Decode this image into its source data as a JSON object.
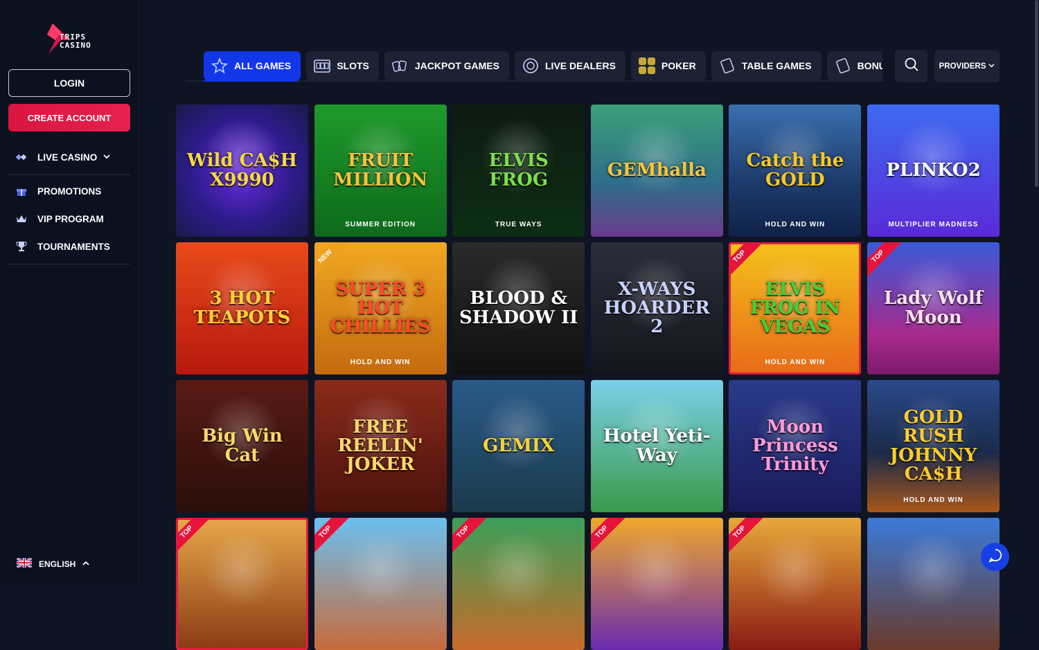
{
  "brand": {
    "logo_line1": "TRIPS",
    "logo_line2": "CASINO",
    "accent": "#e8204f",
    "primary": "#1237e8"
  },
  "sidebar": {
    "login_label": "LOGIN",
    "create_label": "CREATE ACCOUNT",
    "items": [
      {
        "label": "LIVE CASINO",
        "icon": "cards-icon"
      },
      {
        "label": "PROMOTIONS",
        "icon": "gift-icon"
      },
      {
        "label": "VIP PROGRAM",
        "icon": "crown-icon"
      },
      {
        "label": "TOURNAMENTS",
        "icon": "trophy-icon"
      }
    ],
    "language": "ENGLISH"
  },
  "tabs": [
    {
      "label": "ALL GAMES",
      "icon": "star-icon",
      "active": true
    },
    {
      "label": "SLOTS",
      "icon": "slot-machine-icon"
    },
    {
      "label": "JACKPOT GAMES",
      "icon": "jackpot-cards-icon"
    },
    {
      "label": "LIVE DEALERS",
      "icon": "chip-icon"
    },
    {
      "label": "POKER",
      "icon": "poker-icon"
    },
    {
      "label": "TABLE GAMES",
      "icon": "table-card-icon"
    },
    {
      "label": "BONUS B",
      "icon": "bonus-card-icon"
    }
  ],
  "providers_label": "PROVIDERS",
  "games": [
    {
      "title": "Wild CA$H X9990",
      "sub": "",
      "bg": "radial-gradient(circle,#6a2be0 0%,#2d1b8a 55%,#191a4a 100%)",
      "color": "#f6d845"
    },
    {
      "title": "FRUIT MILLION",
      "sub": "SUMMER EDITION",
      "bg": "linear-gradient(180deg,#1f9a2a,#0d6a1c)",
      "color": "#f5c23a"
    },
    {
      "title": "ELVIS FROG",
      "sub": "TRUE WAYS",
      "bg": "linear-gradient(180deg,#0e1a10,#0c2e14)",
      "color": "#7be04a"
    },
    {
      "title": "GEMhalla",
      "sub": "",
      "bg": "linear-gradient(180deg,#3aa07a,#2f6d8a 60%,#6a3a8e)",
      "color": "#f6c53a"
    },
    {
      "title": "Catch the GOLD",
      "sub": "HOLD AND WIN",
      "bg": "linear-gradient(180deg,#3a6fb0,#1c3a6a 60%,#0f2148)",
      "color": "#f7c928"
    },
    {
      "title": "PLINKO2",
      "sub": "MULTIPLIER MADNESS",
      "bg": "linear-gradient(180deg,#3c6af0,#5a2ad8)",
      "color": "#ffffff"
    },
    {
      "title": "3 HOT TEAPOTS",
      "sub": "",
      "bg": "linear-gradient(180deg,#e84a1a,#b8180e)",
      "color": "#ffd23a"
    },
    {
      "title": "SUPER 3 HOT CHILLIES",
      "sub": "HOLD AND WIN",
      "bg": "linear-gradient(180deg,#f0a820,#c46a10)",
      "color": "#ff4a2a",
      "badge": "NEW"
    },
    {
      "title": "BLOOD & SHADOW II",
      "sub": "",
      "bg": "linear-gradient(180deg,#2a2a2a,#101010)",
      "color": "#ffffff"
    },
    {
      "title": "X-WAYS HOARDER 2",
      "sub": "",
      "bg": "linear-gradient(180deg,#2a2e38,#14161c)",
      "color": "#c8d2ff"
    },
    {
      "title": "ELVIS FROG IN VEGAS",
      "sub": "HOLD AND WIN",
      "bg": "linear-gradient(180deg,#f4c21c,#e86a18)",
      "color": "#3fd13a",
      "badge": "TOP",
      "framed": true
    },
    {
      "title": "Lady Wolf Moon",
      "sub": "",
      "bg": "linear-gradient(180deg,#3a5ad8,#a82a8e 70%,#7a1a6a)",
      "color": "#ffe2f2",
      "badge": "TOP"
    },
    {
      "title": "Big Win Cat",
      "sub": "",
      "bg": "linear-gradient(180deg,#5a1a14,#2a0e0a)",
      "color": "#ffd86a"
    },
    {
      "title": "FREE REELIN' JOKER",
      "sub": "",
      "bg": "linear-gradient(180deg,#8a2a1a,#4a120c)",
      "color": "#ffd86a"
    },
    {
      "title": "GEMIX",
      "sub": "",
      "bg": "linear-gradient(180deg,#2a5a8a,#1a3a4a)",
      "color": "#f6d23a"
    },
    {
      "title": "Hotel Yeti-Way",
      "sub": "",
      "bg": "linear-gradient(180deg,#7ad0e8,#3a9a4a)",
      "color": "#ffffff"
    },
    {
      "title": "Moon Princess Trinity",
      "sub": "",
      "bg": "linear-gradient(180deg,#2a3a8a,#1a1a5a)",
      "color": "#ff9ad8"
    },
    {
      "title": "GOLD RUSH JOHNNY CA$H",
      "sub": "HOLD AND WIN",
      "bg": "linear-gradient(180deg,#2a4a8a,#1a2a4a 55%,#a8561a)",
      "color": "#ffcc2a"
    },
    {
      "title": "",
      "sub": "",
      "bg": "linear-gradient(180deg,#e8a84a,#8a3a14)",
      "color": "#ffffff",
      "badge": "TOP",
      "framed": true
    },
    {
      "title": "",
      "sub": "",
      "bg": "linear-gradient(180deg,#6ac0f0,#c86a3a)",
      "color": "#ffffff",
      "badge": "TOP"
    },
    {
      "title": "",
      "sub": "",
      "bg": "linear-gradient(180deg,#3aa05a,#c86a2a)",
      "color": "#ffffff",
      "badge": "TOP"
    },
    {
      "title": "",
      "sub": "",
      "bg": "linear-gradient(180deg,#f0a82a,#6a2ab0)",
      "color": "#ffffff",
      "badge": "TOP"
    },
    {
      "title": "",
      "sub": "",
      "bg": "linear-gradient(180deg,#e8a83a,#8a1a14)",
      "color": "#ffffff",
      "badge": "TOP"
    },
    {
      "title": "",
      "sub": "",
      "bg": "linear-gradient(180deg,#3a7ad8,#6a3a2a)",
      "color": "#ffffff"
    }
  ]
}
